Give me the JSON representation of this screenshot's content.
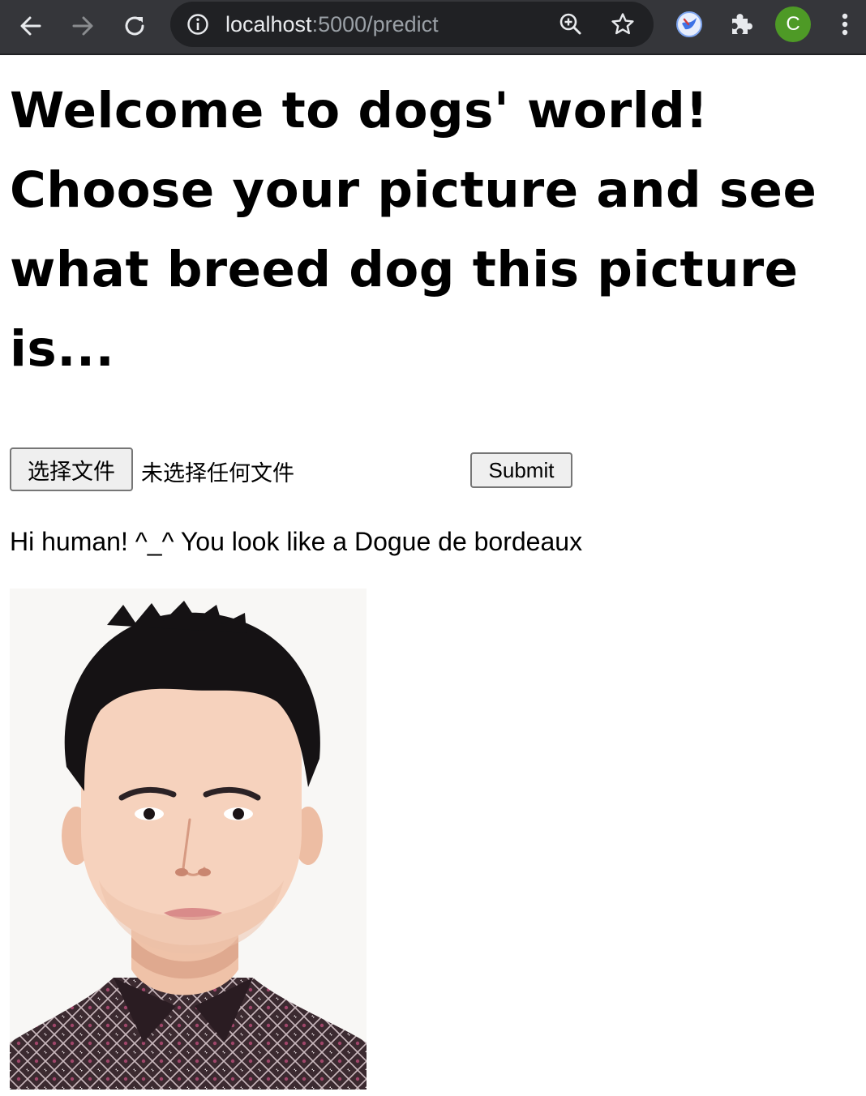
{
  "browser": {
    "url_host": "localhost",
    "url_rest": ":5000/predict",
    "profile_initial": "C",
    "icons": {
      "back": "arrow-left-icon",
      "forward": "arrow-right-icon",
      "reload": "reload-icon",
      "site_info": "info-icon",
      "zoom": "zoom-icon",
      "bookmark": "star-icon",
      "extension": "bird-extension-icon",
      "extensions_menu": "puzzle-icon",
      "menu": "kebab-menu-icon"
    },
    "colors": {
      "toolbar": "#35363a",
      "omnibox": "#202124",
      "avatar": "#4e9a26"
    }
  },
  "page": {
    "heading": "Welcome to dogs' world! Choose your picture and see what breed dog this picture is...",
    "file_button_label": "选择文件",
    "file_status": "未选择任何文件",
    "submit_label": "Submit",
    "result": "Hi human! ^_^ You look like a Dogue de bordeaux"
  }
}
